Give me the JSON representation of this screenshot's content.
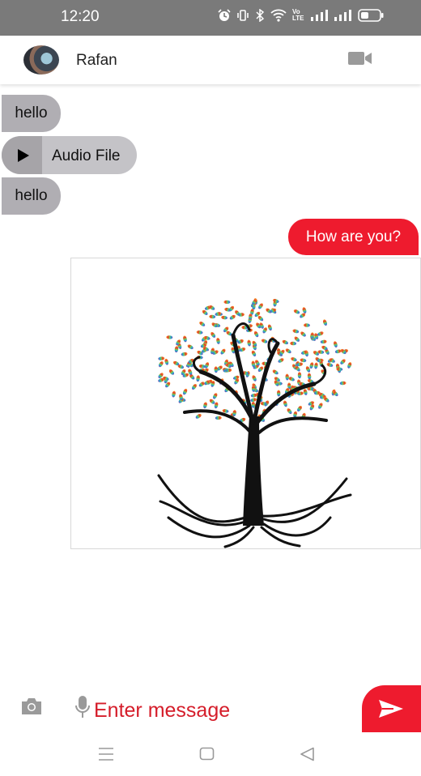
{
  "status_bar": {
    "time": "12:20",
    "icons": [
      "alarm-icon",
      "vibrate-icon",
      "bluetooth-icon",
      "wifi-icon",
      "volte-icon",
      "signal-icon",
      "signal-icon",
      "battery-icon"
    ],
    "volte_text": "Vo LTE"
  },
  "header": {
    "contact_name": "Rafan",
    "icons": [
      "avatar",
      "video-call-icon"
    ]
  },
  "messages": [
    {
      "direction": "incoming",
      "type": "text",
      "text": "hello"
    },
    {
      "direction": "incoming",
      "type": "audio",
      "text": "Audio File",
      "icon": "play-icon"
    },
    {
      "direction": "incoming",
      "type": "text",
      "text": "hello"
    },
    {
      "direction": "outgoing",
      "type": "text",
      "text": "How are you?"
    },
    {
      "direction": "outgoing",
      "type": "image",
      "description_icon": "tree-image"
    }
  ],
  "composer": {
    "placeholder": "Enter message",
    "icons": [
      "camera-icon",
      "mic-icon",
      "send-icon"
    ]
  },
  "nav_bar": {
    "icons": [
      "menu-icon",
      "home-icon",
      "back-icon"
    ]
  },
  "colors": {
    "accent": "#ee1b2e",
    "incoming_bubble": "#b0aeb3",
    "status_bar": "#7a7a7a"
  }
}
